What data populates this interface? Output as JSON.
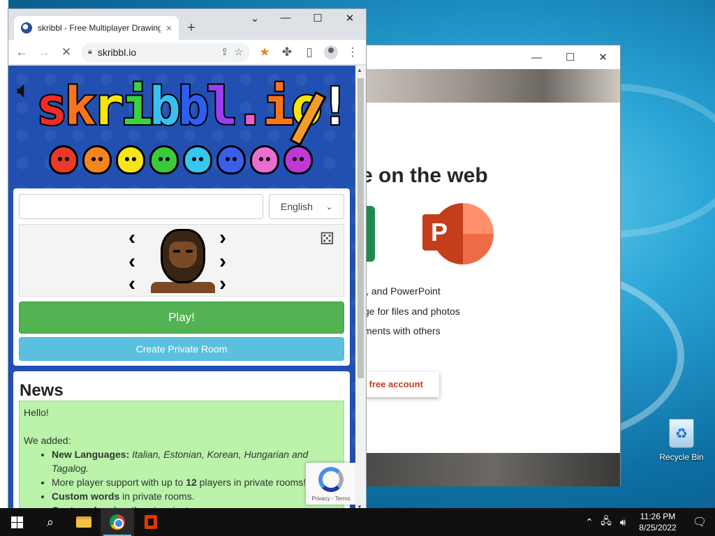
{
  "desktop": {
    "recycle_bin_label": "Recycle Bin"
  },
  "background_window": {
    "headline": "e on the web",
    "feature_1": "l, and PowerPoint",
    "feature_2": "ge for files and photos",
    "feature_3": "ments with others",
    "cta_label": "n free account",
    "ppt_letter": "P"
  },
  "browser": {
    "tab_title": "skribbl - Free Multiplayer Drawing",
    "tab_close": "×",
    "new_tab": "+",
    "url": "skribbl.io",
    "window_controls": {
      "dropdown": "⌄",
      "minimize": "—",
      "maximize": "☐",
      "close": "✕"
    },
    "toolbar": {
      "back": "←",
      "forward": "→",
      "stop": "✕",
      "share": "⇪",
      "bookmark": "☆",
      "extension_star": "★",
      "extensions": "✤",
      "sidepanel": "▯",
      "menu": "⋮"
    }
  },
  "skribbl": {
    "logo_letters": [
      "s",
      "k",
      "r",
      "i",
      "b",
      "b",
      "l",
      ".",
      "i",
      "o",
      "!"
    ],
    "logo_colors": [
      "#ef2d26",
      "#f7741c",
      "#f5e50e",
      "#3cd13e",
      "#38c0f2",
      "#2d5ef2",
      "#9b3ff2",
      "#f25bc3",
      "#f7741c",
      "#f5e50e",
      "#ffffff"
    ],
    "faces": [
      "#e8392b",
      "#f2861c",
      "#f5e51a",
      "#3acb3a",
      "#35c7ee",
      "#3b5ee8",
      "#e86fd0",
      "#c039d6"
    ],
    "name_value": "",
    "language": "English",
    "play_label": "Play!",
    "private_room_label": "Create Private Room",
    "news": {
      "title": "News",
      "hello": "Hello!",
      "we_added": "We added:",
      "items": [
        {
          "bold": "New Languages:",
          "rest": " Italian, Estonian, Korean, Hungarian and Tagalog."
        },
        {
          "pre": "More player support with up to ",
          "bold": "12",
          "rest": " players in private rooms!"
        },
        {
          "bold": "Custom words",
          "rest": " in private rooms."
        },
        {
          "bold": "Custom drawing time",
          "rest": " in private rooms."
        }
      ]
    },
    "recaptcha": {
      "privacy": "Privacy",
      "separator": " - ",
      "terms": "Terms"
    }
  },
  "taskbar": {
    "time": "11:26 PM",
    "date": "8/25/2022",
    "tray_icons": [
      "chevron-up",
      "network",
      "volume"
    ]
  }
}
